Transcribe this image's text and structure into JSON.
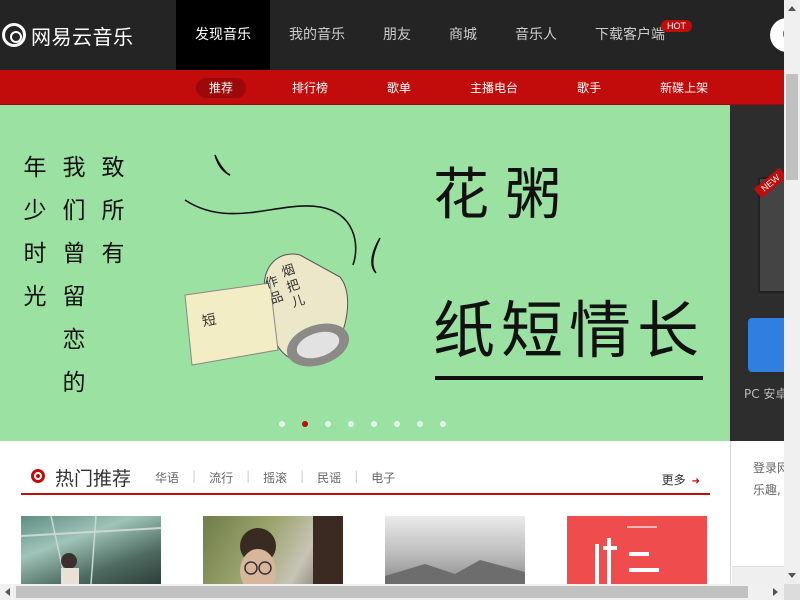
{
  "header": {
    "logo_text": "网易云音乐",
    "nav": [
      {
        "label": "发现音乐",
        "active": true
      },
      {
        "label": "我的音乐"
      },
      {
        "label": "朋友"
      },
      {
        "label": "商城"
      },
      {
        "label": "音乐人"
      },
      {
        "label": "下载客户端",
        "badge": "HOT"
      }
    ]
  },
  "subnav": [
    "推荐",
    "排行榜",
    "歌单",
    "主播电台",
    "歌手",
    "新碟上架"
  ],
  "banner": {
    "col1": "年少时光",
    "col2": "我们曾留恋的",
    "col3": "致所有",
    "title_line1": "花粥",
    "title_line2": "纸短情长",
    "scroll_label_1": "烟把儿",
    "scroll_label_2": "作品",
    "scroll_stamp": "短",
    "dots_count": 8,
    "active_dot": 1
  },
  "right_strip": {
    "badge": "NEW",
    "text": "PC 安卓"
  },
  "hot": {
    "title": "热门推荐",
    "tags": [
      "华语",
      "流行",
      "摇滚",
      "民谣",
      "电子"
    ],
    "more": "更多"
  },
  "right_panel": {
    "line1": "登录网",
    "line2": "乐趣,"
  },
  "colors": {
    "brand_red": "#c20c0c",
    "topbar": "#242424",
    "banner_bg": "#9ae1a2"
  }
}
